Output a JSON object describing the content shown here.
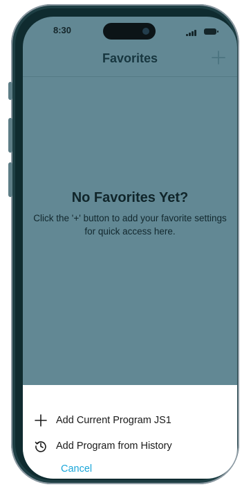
{
  "status_bar": {
    "time": "8:30"
  },
  "header": {
    "title": "Favorites",
    "add_icon": "plus-icon"
  },
  "empty_state": {
    "title": "No Favorites Yet?",
    "message": "Click the '+' button to add your favorite settings for quick access here."
  },
  "sheet": {
    "items": [
      {
        "label": "Add Current Program JS1",
        "icon": "plus-icon"
      },
      {
        "label": "Add Program from History",
        "icon": "history-icon"
      }
    ],
    "cancel_label": "Cancel"
  },
  "colors": {
    "screen_background": "#628894",
    "accent": "#1aa6d9",
    "frame": "#1e3f44"
  }
}
